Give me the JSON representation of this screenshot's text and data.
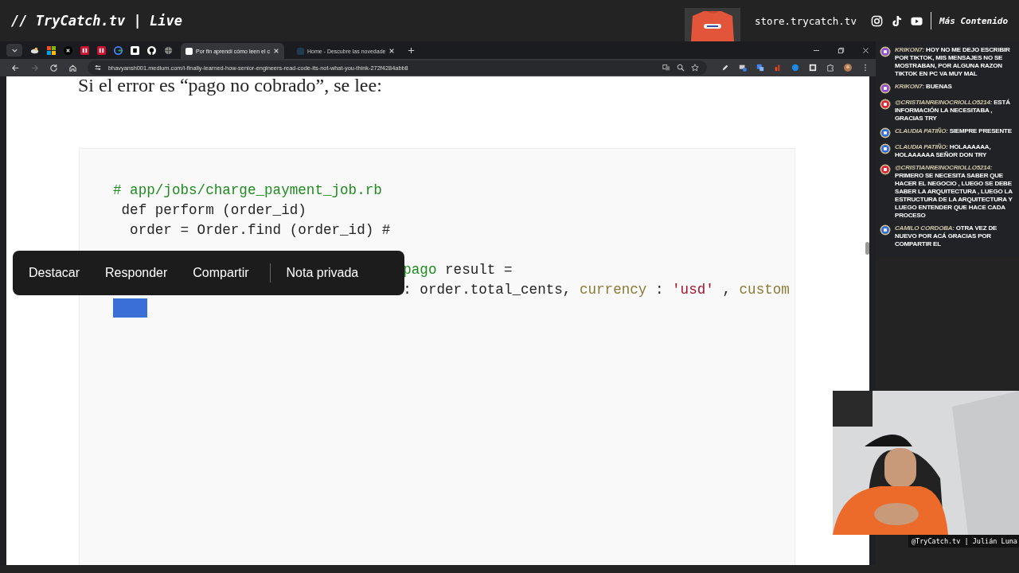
{
  "stream_header": {
    "title": "// TryCatch.tv | Live",
    "store": "store.trycatch.tv",
    "more": "Más Contenido"
  },
  "browser": {
    "tabs": [
      {
        "title": "Por fin aprendí cómo leen el c",
        "selected": true
      },
      {
        "title": "Home - Descubre las novedade",
        "selected": false
      }
    ],
    "url": "bhavyansh001.medium.com/i-finally-learned-how-senior-engineers-read-code-its-not-what-you-think-272f4284abb8"
  },
  "article": {
    "heading": "Si el error es “pago no cobrado”, se lee:",
    "code_lines": [
      {
        "covered": false,
        "tokens": [
          {
            "text": "# app/jobs/charge_payment_job.rb",
            "kind": "comment"
          }
        ]
      },
      {
        "covered": false,
        "tokens": [
          {
            "text": " def perform (order_id)",
            "kind": "plain"
          }
        ]
      },
      {
        "covered": false,
        "tokens": [
          {
            "text": "  order = Order.find (order_id) #",
            "kind": "plain"
          }
        ]
      },
      {
        "covered": true,
        "tokens": [
          {
            "text": "pago",
            "kind": "comment"
          },
          {
            "text": "result =",
            "kind": "plain"
          }
        ]
      },
      {
        "covered": true,
        "tokens": [
          {
            "text": ":",
            "kind": "plain"
          },
          {
            "text": "order.total_cents,",
            "kind": "plain"
          },
          {
            "text": "currency",
            "kind": "key"
          },
          {
            "text": ":",
            "kind": "plain"
          },
          {
            "text": "'usd'",
            "kind": "string"
          },
          {
            "text": ",",
            "kind": "plain"
          },
          {
            "text": "custom",
            "kind": "key"
          }
        ]
      }
    ],
    "toolbar": [
      "Destacar",
      "Responder",
      "Compartir",
      "Nota privada"
    ]
  },
  "chat": [
    {
      "kind": "twitch",
      "author": "KRIKON7:",
      "text": "HOY NO ME DEJO ESCRIBIR POR TIKTOK, MIS MENSAJES NO SE MOSTRABAN, POR ALGUNA RAZON TIKTOK EN PC VA MUY MAL"
    },
    {
      "kind": "twitch",
      "author": "KRIKON7:",
      "text": "BUENAS"
    },
    {
      "kind": "youtube",
      "author": "@CRISTIANREINOCRIOLLO5214:",
      "text": "ESTÁ INFORMACIÓN LA NECESITABA , GRACIAS TRY"
    },
    {
      "kind": "facebook",
      "author": "CLAUDIA PATIÑO:",
      "text": "SIEMPRE PRESENTE"
    },
    {
      "kind": "facebook",
      "author": "CLAUDIA PATIÑO:",
      "text": "HOLAAAAAA, HOLAAAAAA SEÑOR DON TRY"
    },
    {
      "kind": "youtube",
      "author": "@CRISTIANREINOCRIOLLO5214:",
      "text": "PRIMERO SE NECESITA SABER QUE HACER EL NEGOCIO , LUEGO SE DEBE SABER LA ARQUITECTURA , LUEGO LA ESTRUCTURA DE LA ARQUITECTURA Y LUEGO ENTENDER QUE HACE CADA PROCESO"
    },
    {
      "kind": "facebook",
      "author": "CAMILO CORDOBA:",
      "text": "OTRA VEZ DE NUEVO POR ACÁ GRACIAS POR COMPARTIR EL"
    }
  ],
  "webcam": {
    "kind": "picture",
    "caption": "@TryCatch.tv | Julián Luna"
  }
}
